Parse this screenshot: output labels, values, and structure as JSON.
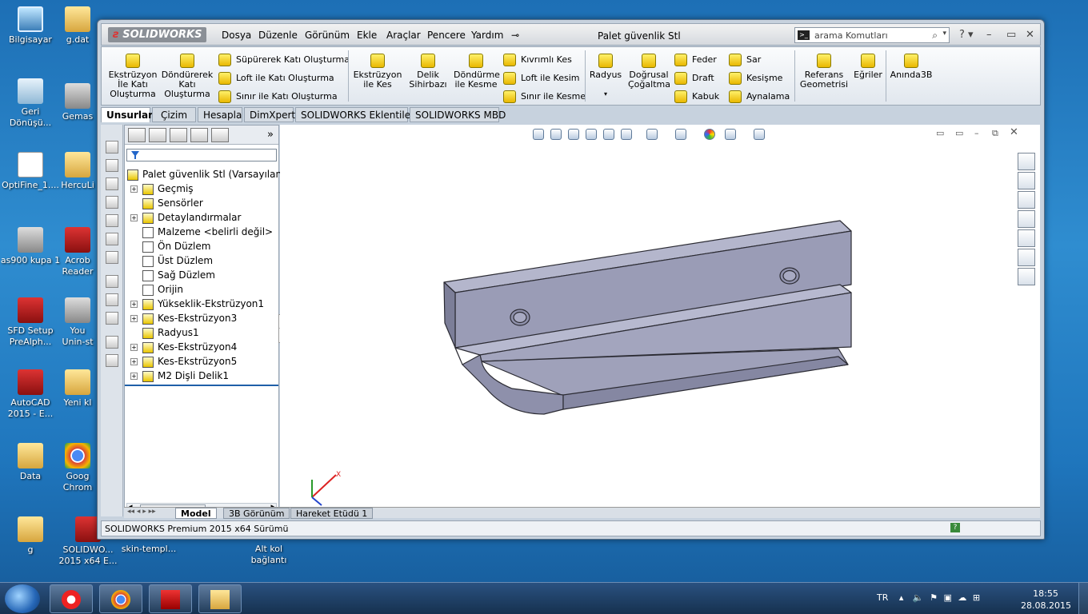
{
  "desktop": {
    "icons": [
      {
        "label": "Bilgisayar",
        "icon": "computer-icon"
      },
      {
        "label": "g.dat",
        "icon": "folder-icon"
      },
      {
        "label": "Geri Dönüşü...",
        "icon": "recycle-bin-icon"
      },
      {
        "label": "Gemas",
        "icon": "app-icon"
      },
      {
        "label": "OptiFine_1....",
        "icon": "java-icon"
      },
      {
        "label": "HercuLi",
        "icon": "folder-icon"
      },
      {
        "label": "as900 kupa 1",
        "icon": "part-icon"
      },
      {
        "label": "Acrob Reader",
        "icon": "acrobat-icon"
      },
      {
        "label": "SFD Setup PreAlph...",
        "icon": "setup-icon"
      },
      {
        "label": "You Unin-st",
        "icon": "uninstall-icon"
      },
      {
        "label": "AutoCAD 2015 - E...",
        "icon": "autocad-icon"
      },
      {
        "label": "Yeni kl",
        "icon": "folder-icon"
      },
      {
        "label": "Data",
        "icon": "folder-icon"
      },
      {
        "label": "Goog Chrom",
        "icon": "chrome-icon"
      },
      {
        "label": "g",
        "icon": "folder-icon"
      },
      {
        "label": "SOLIDWO... 2015 x64 E...",
        "icon": "solidworks-icon"
      },
      {
        "label": "skin-templ...",
        "icon": "file-icon"
      },
      {
        "label": "Alt kol bağlantı",
        "icon": "file-icon"
      }
    ]
  },
  "window": {
    "logo": "SOLIDWORKS",
    "menu": [
      "Dosya",
      "Düzenle",
      "Görünüm",
      "Ekle",
      "Araçlar",
      "Pencere",
      "Yardım"
    ],
    "title": "Palet güvenlik Stl",
    "search_placeholder": "arama Komutları",
    "help": "?"
  },
  "ribbon": {
    "extrude_boss": "Ekstrüzyon İle Katı Oluşturma",
    "revolve_boss": "Döndürerek Katı Oluşturma",
    "sweep_boss": "Süpürerek Katı Oluşturma",
    "loft_boss": "Loft ile Katı Oluşturma",
    "boundary_boss": "Sınır ile Katı Oluşturma",
    "extrude_cut": "Ekstrüzyon ile Kes",
    "hole_wizard": "Delik Sihirbazı",
    "revolve_cut": "Döndürme ile Kesme",
    "swept_cut": "Kıvrımlı Kes",
    "loft_cut": "Loft ile Kesim",
    "boundary_cut": "Sınır ile Kesme",
    "fillet": "Radyus",
    "linear_pattern": "Doğrusal Çoğaltma",
    "rib": "Feder",
    "draft": "Draft",
    "shell": "Kabuk",
    "wrap": "Sar",
    "intersect": "Kesişme",
    "mirror": "Aynalama",
    "ref_geom": "Referans Geometrisi",
    "curves": "Eğriler",
    "instant3d": "Anında3B"
  },
  "tabs": [
    "Unsurlar",
    "Çizim",
    "Hesapla",
    "DimXpert",
    "SOLIDWORKS Eklentileri",
    "SOLIDWORKS MBD"
  ],
  "tree": {
    "root": "Palet güvenlik Stl  (Varsayılan<<",
    "items": [
      "Geçmiş",
      "Sensörler",
      "Detaylandırmalar",
      "Malzeme <belirli değil>",
      "Ön Düzlem",
      "Üst Düzlem",
      "Sağ Düzlem",
      "Orijin",
      "Yükseklik-Ekstrüzyon1",
      "Kes-Ekstrüzyon3",
      "Radyus1",
      "Kes-Ekstrüzyon4",
      "Kes-Ekstrüzyon5",
      "M2 Dişli Delik1"
    ]
  },
  "bottom_tabs": [
    "Model",
    "3B Görünüm",
    "Hareket Etüdü 1"
  ],
  "status": "SOLIDWORKS Premium 2015 x64 Sürümü",
  "axis": {
    "x": "X"
  },
  "taskbar": {
    "lang": "TR",
    "time": "18:55",
    "date": "28.08.2015"
  },
  "colors": {
    "part": "#9a9cb6",
    "part_edge": "#2b2b33",
    "accent": "#1f76bd"
  }
}
